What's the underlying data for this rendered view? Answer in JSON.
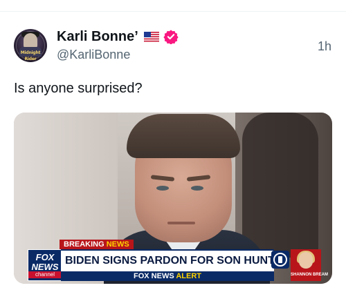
{
  "post": {
    "author": {
      "display_name": "Karli Bonne’",
      "handle": "@KarliBonne",
      "flag": "us-flag-icon",
      "verified": true,
      "avatar_text": "Midnight Rider"
    },
    "timestamp": "1h",
    "text": "Is anyone surprised?"
  },
  "media": {
    "breaking_prefix": "BREAKING",
    "breaking_suffix": "NEWS",
    "headline": "BIDEN SIGNS PARDON FOR SON HUNTER",
    "network_line1": "FOX",
    "network_line2": "NEWS",
    "network_line3": "channel",
    "alert_prefix": "FOX NEWS",
    "alert_suffix": "ALERT",
    "anchor_name": "SHANNON BREAM"
  },
  "colors": {
    "verified": "#f91880",
    "fox_blue": "#0a2a66",
    "fox_red": "#b8151a",
    "accent_yellow": "#ffd200"
  }
}
